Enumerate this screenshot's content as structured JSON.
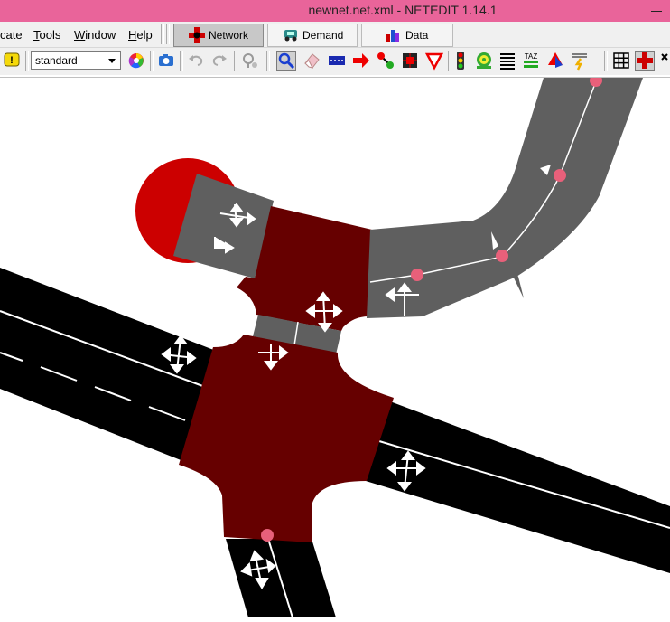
{
  "window": {
    "title": "newnet.net.xml - NETEDIT 1.14.1"
  },
  "menu": {
    "items": [
      "cate",
      "Tools",
      "Window",
      "Help"
    ]
  },
  "supermodes": [
    {
      "label": "Network",
      "active": true,
      "icon": "network-icon"
    },
    {
      "label": "Demand",
      "active": false,
      "icon": "demand-icon"
    },
    {
      "label": "Data",
      "active": false,
      "icon": "data-icon"
    }
  ],
  "toolbar": {
    "scheme_value": "standard",
    "tools": [
      "help-icon",
      "color-wheel-icon",
      "screenshot-icon",
      "undo-icon",
      "redo-icon",
      "locate-icon",
      "inspect-icon",
      "delete-icon",
      "select-icon",
      "move-icon",
      "create-edge-icon",
      "connection-icon",
      "prohibition-icon",
      "traffic-light-icon",
      "additional-icon",
      "crossing-icon",
      "taz-icon",
      "shape-icon",
      "wire-icon",
      "grid-icon",
      "junction-shape-icon",
      "toggle-icon"
    ],
    "taz_label": "TAZ"
  },
  "colors": {
    "title_bar": "#e9649a",
    "junction": "#660000",
    "edge_selected": "#5f5f5f",
    "edge": "#000000",
    "junction_bubble": "#cc0000",
    "geometry_point": "#e8607a"
  }
}
